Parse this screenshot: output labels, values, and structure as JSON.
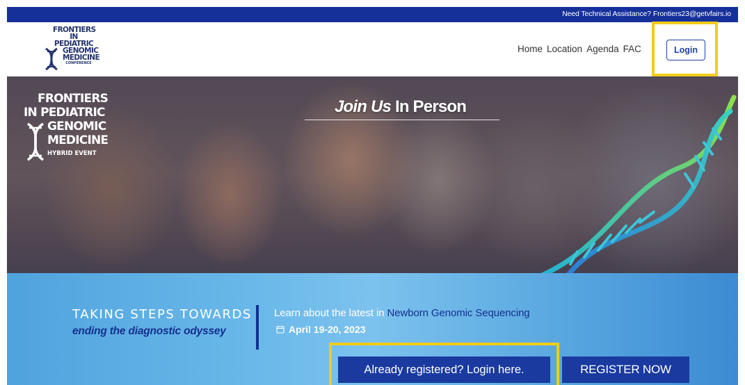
{
  "topbar": {
    "assistance_text": "Need Technical Assistance? Frontiers23@getvfairs.io"
  },
  "logo": {
    "line1": "FRONTIERS",
    "line2": "IN PEDIATRIC",
    "line3": "GENOMIC",
    "line4": "MEDICINE",
    "line5": "CONFERENCE",
    "icon": "dna-helix-icon"
  },
  "nav": {
    "items": [
      {
        "label": "Home"
      },
      {
        "label": "Location"
      },
      {
        "label": "Agenda"
      },
      {
        "label": "FAC"
      }
    ],
    "login_label": "Login"
  },
  "hero": {
    "logo_line1": "FRONTIERS",
    "logo_line2": "IN PEDIATRIC",
    "logo_line3": "GENOMIC",
    "logo_line4": "MEDICINE",
    "logo_line5": "HYBRID EVENT",
    "title_em": "Join Us",
    "title_rest": " In Person"
  },
  "band": {
    "tagline_top": "TAKING STEPS TOWARDS",
    "tagline_bottom": "ending the diagnostic odyssey",
    "learn_prefix": "Learn about the latest in ",
    "learn_highlight": "Newborn Genomic Sequencing",
    "date": "April 19-20, 2023",
    "login_here_label": "Already registered? Login here.",
    "register_label": "REGISTER NOW"
  },
  "colors": {
    "brand_blue": "#16309a",
    "button_blue": "#1a3aa0",
    "highlight_yellow": "#f3cb1a",
    "band_light": "#7cc2ee"
  }
}
